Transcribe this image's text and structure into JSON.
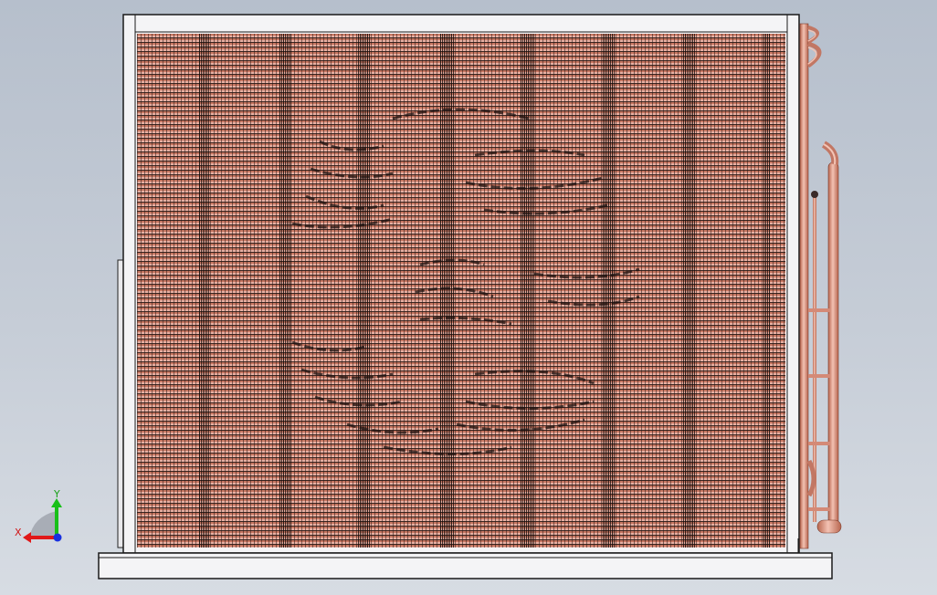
{
  "viewport": {
    "model": "condenser-coil-assembly",
    "view": "front",
    "background_gradient": [
      "#b6bfcc",
      "#d7dce3"
    ]
  },
  "colors": {
    "frame": "#f4f4f6",
    "frame_edge": "#1a1a1a",
    "copper": "#d98c7a",
    "copper_dark": "#b8664f",
    "fin_lines": "#2a1a16",
    "axis_x": "#e01818",
    "axis_y": "#18c018",
    "axis_z": "#1830e0"
  },
  "triad": {
    "x_label": "X",
    "y_label": "Y"
  }
}
